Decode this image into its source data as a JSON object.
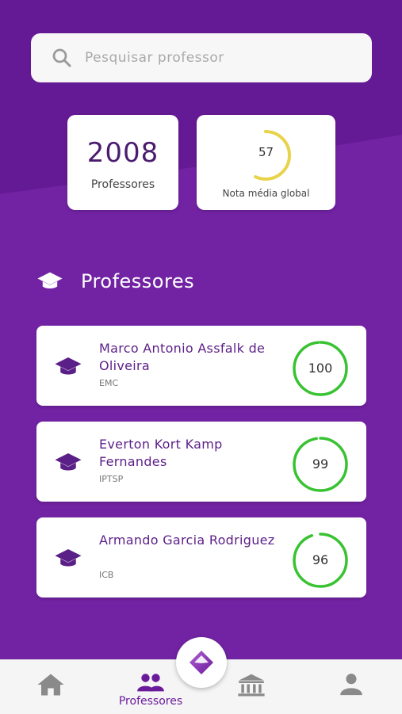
{
  "search": {
    "placeholder": "Pesquisar professor"
  },
  "stats": {
    "count": "2008",
    "count_label": "Professores",
    "global_avg": "57",
    "global_avg_fraction": 0.57,
    "global_avg_label": "Nota média global"
  },
  "section": {
    "title": "Professores"
  },
  "professors": [
    {
      "name": "Marco Antonio Assfalk de Oliveira",
      "dept": "EMC",
      "score": "100",
      "score_fraction": 1.0
    },
    {
      "name": "Everton Kort Kamp Fernandes",
      "dept": "IPTSP",
      "score": "99",
      "score_fraction": 0.99
    },
    {
      "name": "Armando Garcia Rodriguez",
      "dept": "ICB",
      "score": "96",
      "score_fraction": 0.96
    }
  ],
  "nav": {
    "professors_label": "Professores",
    "home_icon": "home-icon",
    "people_icon": "people-icon",
    "institution_icon": "institution-icon",
    "profile_icon": "person-icon"
  },
  "colors": {
    "primary": "#6a1b9a",
    "accent_yellow": "#e8d34a",
    "score_green": "#39c232"
  }
}
